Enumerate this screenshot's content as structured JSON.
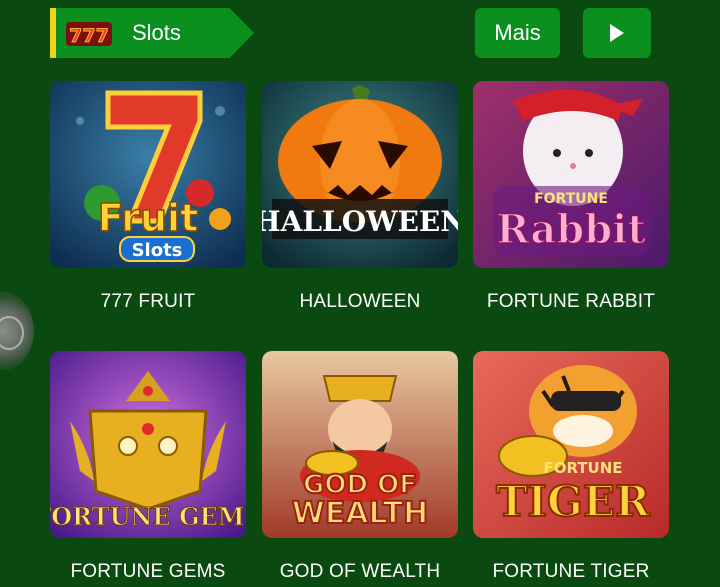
{
  "header": {
    "title": "Slots",
    "slots_icon_text": "777",
    "more_label": "Mais",
    "next_icon": "play-triangle-icon"
  },
  "colors": {
    "background": "#0a4a10",
    "button": "#0b8f1f",
    "accent_stripe": "#f2d318"
  },
  "games": [
    {
      "name": "777 FRUIT",
      "art_text_top": "Fruit",
      "art_text_bottom": "Slots"
    },
    {
      "name": "HALLOWEEN",
      "art_text": "HALLOWEEN"
    },
    {
      "name": "FORTUNE RABBIT",
      "art_text_top": "FORTUNE",
      "art_text_bottom": "Rabbit"
    },
    {
      "name": "FORTUNE GEMS",
      "art_text": "FORTUNE GEMS"
    },
    {
      "name": "GOD OF WEALTH",
      "art_text_top": "GOD OF",
      "art_text_bottom": "WEALTH"
    },
    {
      "name": "FORTUNE TIGER",
      "art_text_top": "FORTUNE",
      "art_text_bottom": "TIGER"
    }
  ]
}
